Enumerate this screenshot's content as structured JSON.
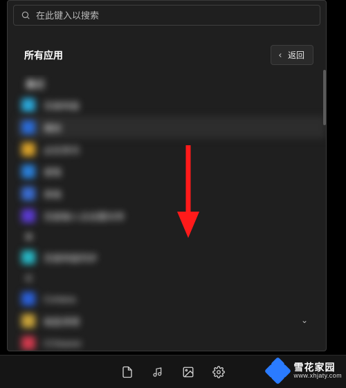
{
  "search": {
    "placeholder": "在此键入以搜索"
  },
  "header": {
    "title": "所有应用",
    "back_label": "返回"
  },
  "groups": {
    "g0": "最近",
    "g1": "B",
    "g2": "C"
  },
  "apps": [
    {
      "label": "百度网盘",
      "color": "#2aa6d8"
    },
    {
      "label": "播放",
      "color": "#2a6bd8",
      "selected": true
    },
    {
      "label": "必应资讯",
      "color": "#d8a12a"
    },
    {
      "label": "便笺",
      "color": "#2a7fd8"
    },
    {
      "label": "表格",
      "color": "#3a6cd0"
    },
    {
      "label": "百度输入法设置向导",
      "color": "#5a3ad0"
    },
    {
      "label": "百度网盘同步",
      "color": "#27b6c4"
    },
    {
      "label": "Cortana",
      "color": "#2a5fd8"
    },
    {
      "label": "磁盘清理",
      "color": "#c9a33a"
    },
    {
      "label": "CCleaner",
      "color": "#d03a4d"
    }
  ],
  "taskbar": {
    "items": [
      "document",
      "music",
      "picture",
      "settings"
    ]
  },
  "watermark": {
    "brand": "雪花家园",
    "url": "www.xhjaty.com"
  }
}
